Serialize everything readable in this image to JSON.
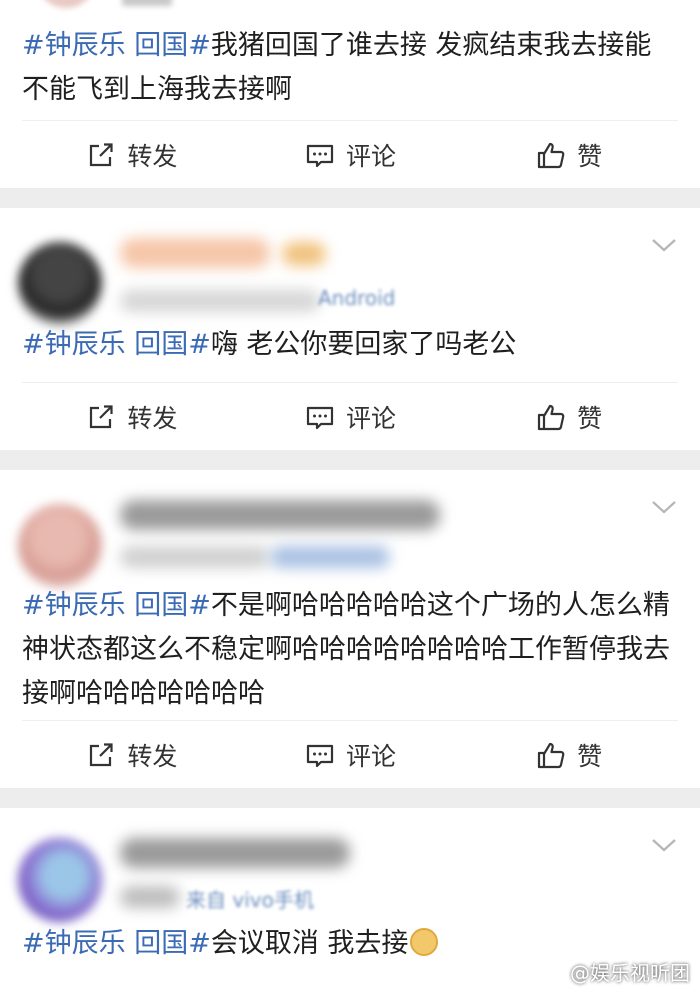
{
  "actions": {
    "repost": "转发",
    "comment": "评论",
    "like": "赞"
  },
  "posts": [
    {
      "tag": "#钟辰乐 回国#",
      "body": "我猪回国了谁去接 发疯结束我去接能不能飞到上海我去接啊",
      "meta_fragment": ""
    },
    {
      "tag": "#钟辰乐 回国#",
      "body": "嗨 老公你要回家了吗老公",
      "meta_fragment": "Android"
    },
    {
      "tag": "#钟辰乐 回国#",
      "body": "不是啊哈哈哈哈哈这个广场的人怎么精神状态都这么不稳定啊哈哈哈哈哈哈哈哈工作暂停我去接啊哈哈哈哈哈哈哈",
      "meta_fragment": ""
    },
    {
      "tag": "#钟辰乐 回国#",
      "body": "会议取消 我去接",
      "meta_fragment": "来自 vivo手机"
    }
  ],
  "watermark": "@娱乐视听团",
  "colors": {
    "topic": "#3b6bb4",
    "background": "#ededed",
    "card": "#ffffff"
  }
}
